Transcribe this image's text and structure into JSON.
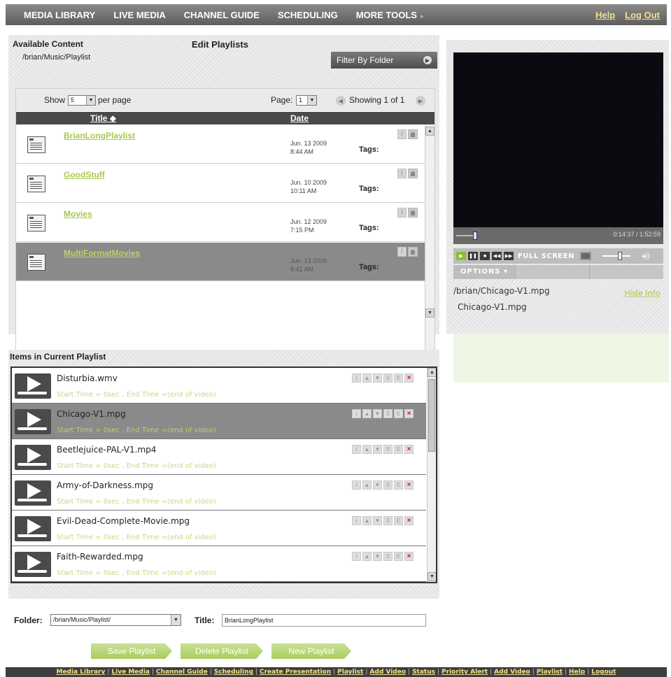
{
  "topnav": {
    "items": [
      "MEDIA LIBRARY",
      "LIVE MEDIA",
      "CHANNEL GUIDE",
      "SCHEDULING",
      "MORE TOOLS"
    ],
    "more_arrow": "»",
    "help": "Help",
    "logout": "Log Out"
  },
  "available": {
    "heading": "Available Content",
    "edit_heading": "Edit Playlists",
    "path": "/brian/Music/Playlist",
    "filter_label": "Filter By Folder",
    "show_label": "Show",
    "per_page_value": "5",
    "per_page_label": "per page",
    "page_label": "Page:",
    "page_value": "1",
    "showing": "Showing 1 of 1",
    "col_title": "Title",
    "col_date": "Date",
    "tags_label": "Tags:",
    "rows": [
      {
        "title": "BrianLongPlaylist",
        "date": "Jun. 13 2009",
        "time": "8:44 AM"
      },
      {
        "title": "GoodStuff",
        "date": "Jun. 10 2009",
        "time": "10:11 AM"
      },
      {
        "title": "Movies",
        "date": "Jun. 12 2009",
        "time": "7:15 PM"
      },
      {
        "title": "MultiFormatMovies",
        "date": "Jun. 13 2009",
        "time": "8:41 AM"
      }
    ]
  },
  "player": {
    "time": "0:14:37 / 1:52:59",
    "fullscreen": "FULL SCREEN",
    "options": "OPTIONS",
    "path": "/brian/Chicago-V1.mpg",
    "hide_info": "Hide Info",
    "name": "Chicago-V1.mpg"
  },
  "playlist": {
    "heading": "Items in Current Playlist",
    "time_text": "Start Time = 0sec , End Time =(end of video)",
    "items": [
      {
        "name": "Disturbia.wmv"
      },
      {
        "name": "Chicago-V1.mpg"
      },
      {
        "name": "Beetlejuice-PAL-V1.mp4"
      },
      {
        "name": "Army-of-Darkness.mpg"
      },
      {
        "name": "Evil-Dead-Complete-Movie.mpg"
      },
      {
        "name": "Faith-Rewarded.mpg"
      }
    ]
  },
  "form": {
    "folder_label": "Folder:",
    "folder_value": "/brian/Music/Playlist/",
    "title_label": "Title:",
    "title_value": "BrianLongPlaylist",
    "save": "Save Playlist",
    "delete": "Delete Playlist",
    "new": "New Playlist"
  },
  "footer": {
    "links": [
      "Media Library",
      "Live Media",
      "Channel Guide",
      "Scheduling",
      "Create Presentation",
      "Playlist",
      "Add Video",
      "Status",
      "Priority Alert",
      "Add Video",
      "Playlist",
      "Help",
      "Logout"
    ]
  },
  "colors": {
    "accent_green": "#a8c850",
    "nav_gray": "#5e5e5e",
    "link_yellow": "#f2e089",
    "delete_red": "#d21a1a"
  }
}
